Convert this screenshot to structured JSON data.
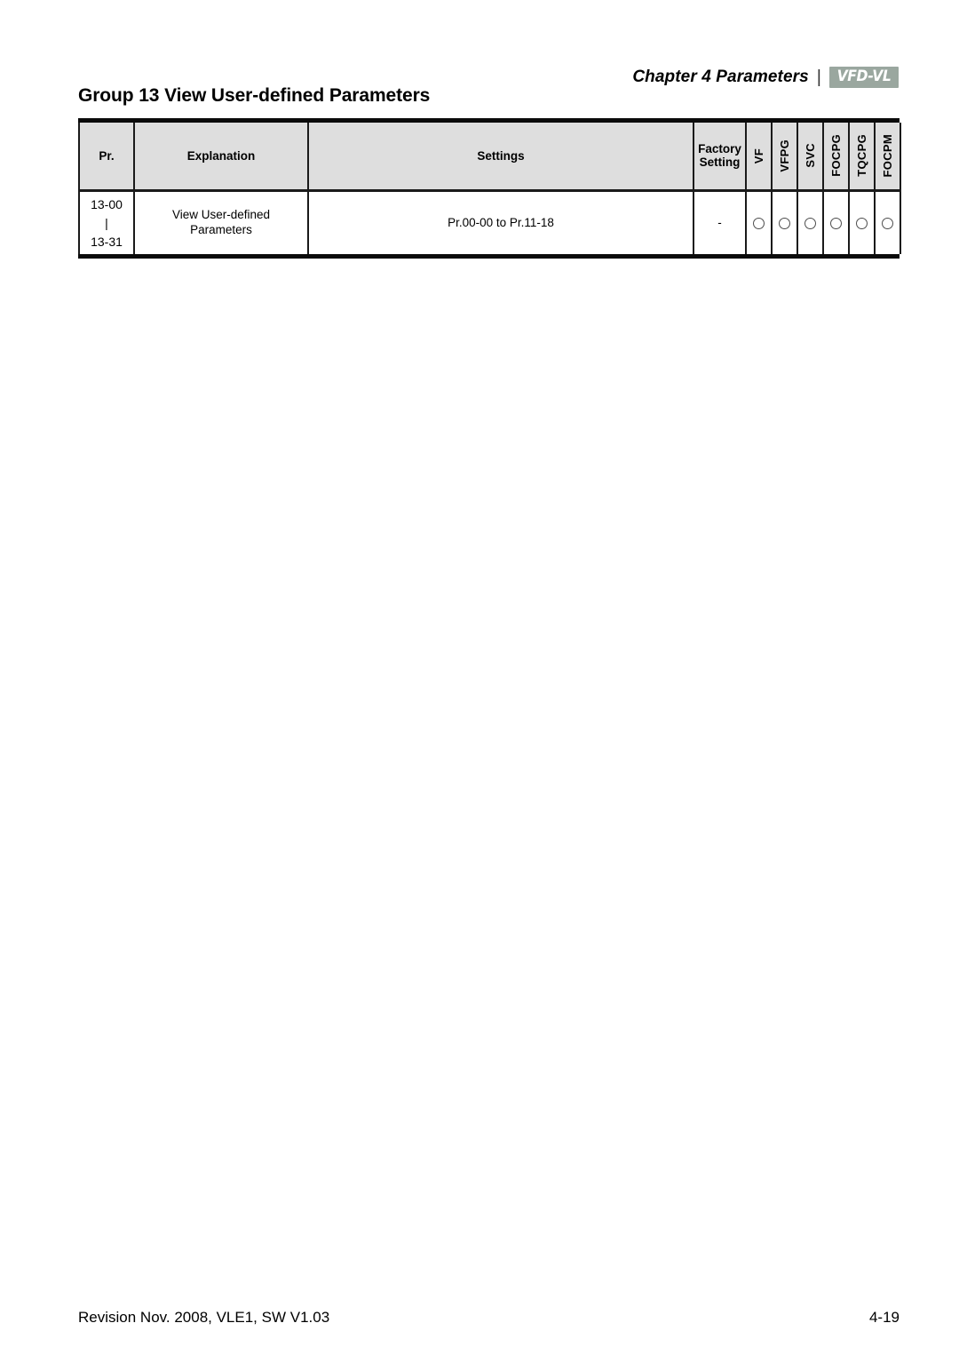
{
  "header": {
    "chapter_label": "Chapter 4 Parameters",
    "divider": "|",
    "logo_text": "VFD-VL",
    "logo_color": "#9aa79f"
  },
  "group_title": "Group 13 View User-defined Parameters",
  "table": {
    "columns": {
      "pr": "Pr.",
      "explanation": "Explanation",
      "settings": "Settings",
      "factory_setting_line1": "Factory",
      "factory_setting_line2": "Setting",
      "modes": [
        "VF",
        "VFPG",
        "SVC",
        "FOCPG",
        "TQCPG",
        "FOCPM"
      ]
    },
    "rows": [
      {
        "pr_start": "13-00",
        "pr_separator": "|",
        "pr_end": "13-31",
        "explanation_line1": "View User-defined",
        "explanation_line2": "Parameters",
        "settings": "Pr.00-00 to Pr.11-18",
        "factory_setting": "-",
        "mode_marks": [
          "circle",
          "circle",
          "circle",
          "circle",
          "circle",
          "circle"
        ]
      }
    ]
  },
  "footer": {
    "revision": "Revision Nov. 2008, VLE1, SW V1.03",
    "page_number": "4-19"
  }
}
